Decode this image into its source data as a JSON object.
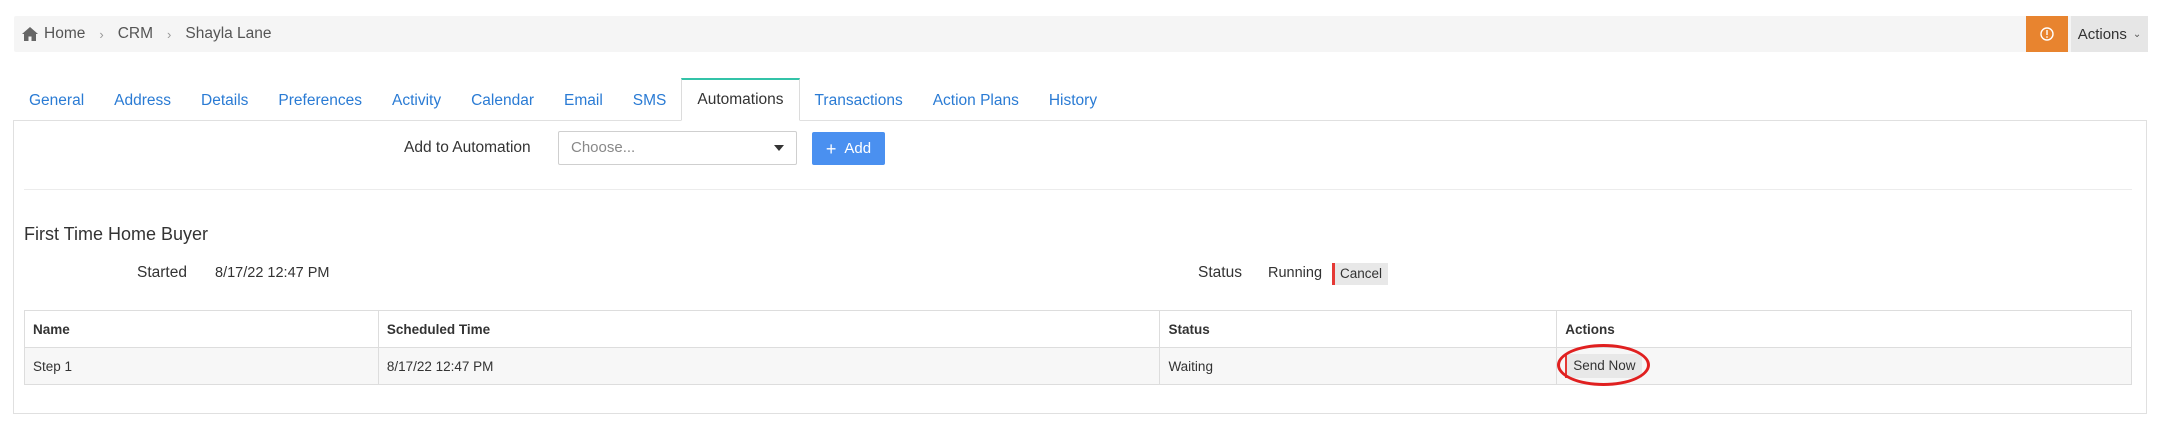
{
  "breadcrumb": {
    "items": [
      "Home",
      "CRM",
      "Shayla Lane"
    ]
  },
  "header": {
    "actions_label": "Actions",
    "alert_icon": "info-icon"
  },
  "tabs": [
    {
      "label": "General"
    },
    {
      "label": "Address"
    },
    {
      "label": "Details"
    },
    {
      "label": "Preferences"
    },
    {
      "label": "Activity"
    },
    {
      "label": "Calendar"
    },
    {
      "label": "Email"
    },
    {
      "label": "SMS"
    },
    {
      "label": "Automations",
      "active": true
    },
    {
      "label": "Transactions"
    },
    {
      "label": "Action Plans"
    },
    {
      "label": "History"
    }
  ],
  "add_automation": {
    "label": "Add to Automation",
    "placeholder": "Choose...",
    "add_label": "Add"
  },
  "automation": {
    "title": "First Time Home Buyer",
    "started_label": "Started",
    "started_value": "8/17/22 12:47 PM",
    "status_label": "Status",
    "status_value": "Running",
    "cancel_label": "Cancel"
  },
  "steps_table": {
    "headers": [
      "Name",
      "Scheduled Time",
      "Status",
      "Actions"
    ],
    "rows": [
      {
        "name": "Step 1",
        "scheduled": "8/17/22 12:47 PM",
        "status": "Waiting",
        "action": "Send Now"
      }
    ]
  },
  "colors": {
    "accent_tab": "#33c3a8",
    "primary_button": "#4a90f0",
    "alert_button": "#e8842f",
    "highlight": "#e02020"
  }
}
